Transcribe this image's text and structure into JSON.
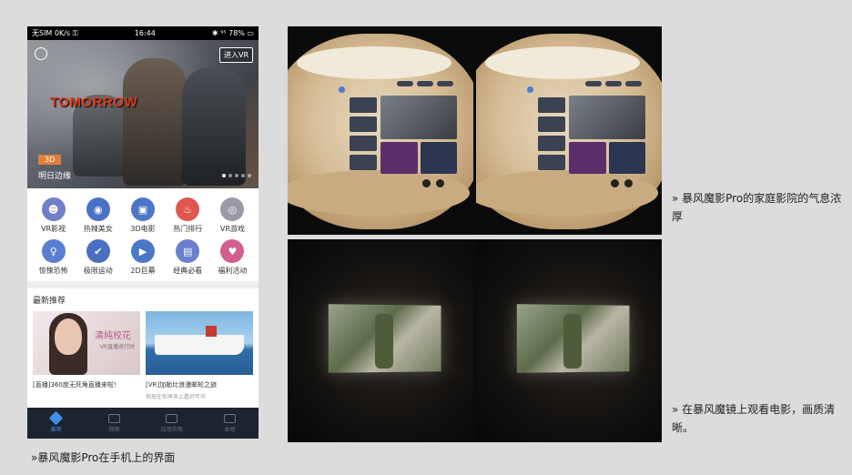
{
  "phone": {
    "status_left": "无SIM 0K/s ⚿",
    "status_time": "16:44",
    "status_right": "✱ ⁹⁵ 78% ▭",
    "hero": {
      "vr_button": "进入VR",
      "movie_title": "TOMORROW",
      "tag": "3D",
      "caption": "明日边缘"
    },
    "categories": [
      {
        "label": "VR影视",
        "color": "#6f7fc8",
        "icon": "☻"
      },
      {
        "label": "热辣美女",
        "color": "#4a72c4",
        "icon": "◉"
      },
      {
        "label": "3D电影",
        "color": "#4c76c6",
        "icon": "▣"
      },
      {
        "label": "热门排行",
        "color": "#e0574e",
        "icon": "♨"
      },
      {
        "label": "VR游戏",
        "color": "#9a9aa6",
        "icon": "◎"
      },
      {
        "label": "惊悚恐怖",
        "color": "#5a7ed0",
        "icon": "♀"
      },
      {
        "label": "极限运动",
        "color": "#4a6fc0",
        "icon": "✔"
      },
      {
        "label": "2D巨幕",
        "color": "#4a78c8",
        "icon": "▶"
      },
      {
        "label": "经典必看",
        "color": "#6a7fce",
        "icon": "▤"
      },
      {
        "label": "福利活动",
        "color": "#d45f8e",
        "icon": "♥"
      }
    ],
    "latest": {
      "header": "最新推荐",
      "cards": [
        {
          "title": "[直播]360度无死角直播来啦！",
          "sub": "",
          "overlay1": "清纯校花",
          "overlay2": "VR直播进行时"
        },
        {
          "title": "[VR]加勒比浪漫邮轮之旅",
          "sub": "但现在你再来上看好年华"
        }
      ]
    },
    "tabs": [
      {
        "label": "推荐",
        "active": true
      },
      {
        "label": "视频",
        "active": false
      },
      {
        "label": "应用市场",
        "active": false
      },
      {
        "label": "本地",
        "active": false
      }
    ]
  },
  "captions": {
    "main": "»暴风魔影Pro在手机上的界面",
    "top_right": "» 暴风魔影Pro的家庭影院的气息浓厚",
    "bottom_right": "» 在暴风魔镜上观看电影，画质清晰。"
  }
}
